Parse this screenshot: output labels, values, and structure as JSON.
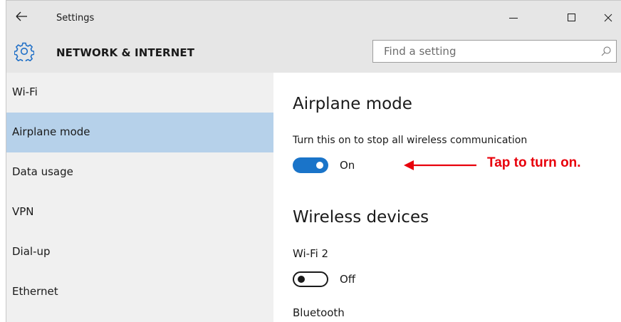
{
  "window": {
    "title": "Settings",
    "controls": {
      "minimize_icon": "minimize-icon",
      "maximize_icon": "maximize-icon",
      "close_icon": "close-icon"
    }
  },
  "header": {
    "section_title": "NETWORK & INTERNET",
    "icon": "gear-icon",
    "search": {
      "value": "",
      "placeholder": "Find a setting",
      "icon": "search-icon"
    }
  },
  "sidebar": {
    "items": [
      {
        "label": "Wi-Fi",
        "selected": false
      },
      {
        "label": "Airplane mode",
        "selected": true
      },
      {
        "label": "Data usage",
        "selected": false
      },
      {
        "label": "VPN",
        "selected": false
      },
      {
        "label": "Dial-up",
        "selected": false
      },
      {
        "label": "Ethernet",
        "selected": false
      }
    ]
  },
  "main": {
    "airplane": {
      "heading": "Airplane mode",
      "description": "Turn this on to stop all wireless communication",
      "toggle": {
        "state": "on",
        "label": "On"
      }
    },
    "wireless": {
      "heading": "Wireless devices",
      "wifi2": {
        "label": "Wi-Fi 2",
        "toggle": {
          "state": "off",
          "label": "Off"
        }
      },
      "bluetooth": {
        "label": "Bluetooth"
      }
    }
  },
  "annotation": {
    "text": "Tap to turn on.",
    "color": "#e8000b"
  },
  "colors": {
    "accent": "#1a74c9",
    "selected_nav": "#b6d1ea",
    "header_bg": "#e6e6e6",
    "sidebar_bg": "#f0f0f0"
  }
}
